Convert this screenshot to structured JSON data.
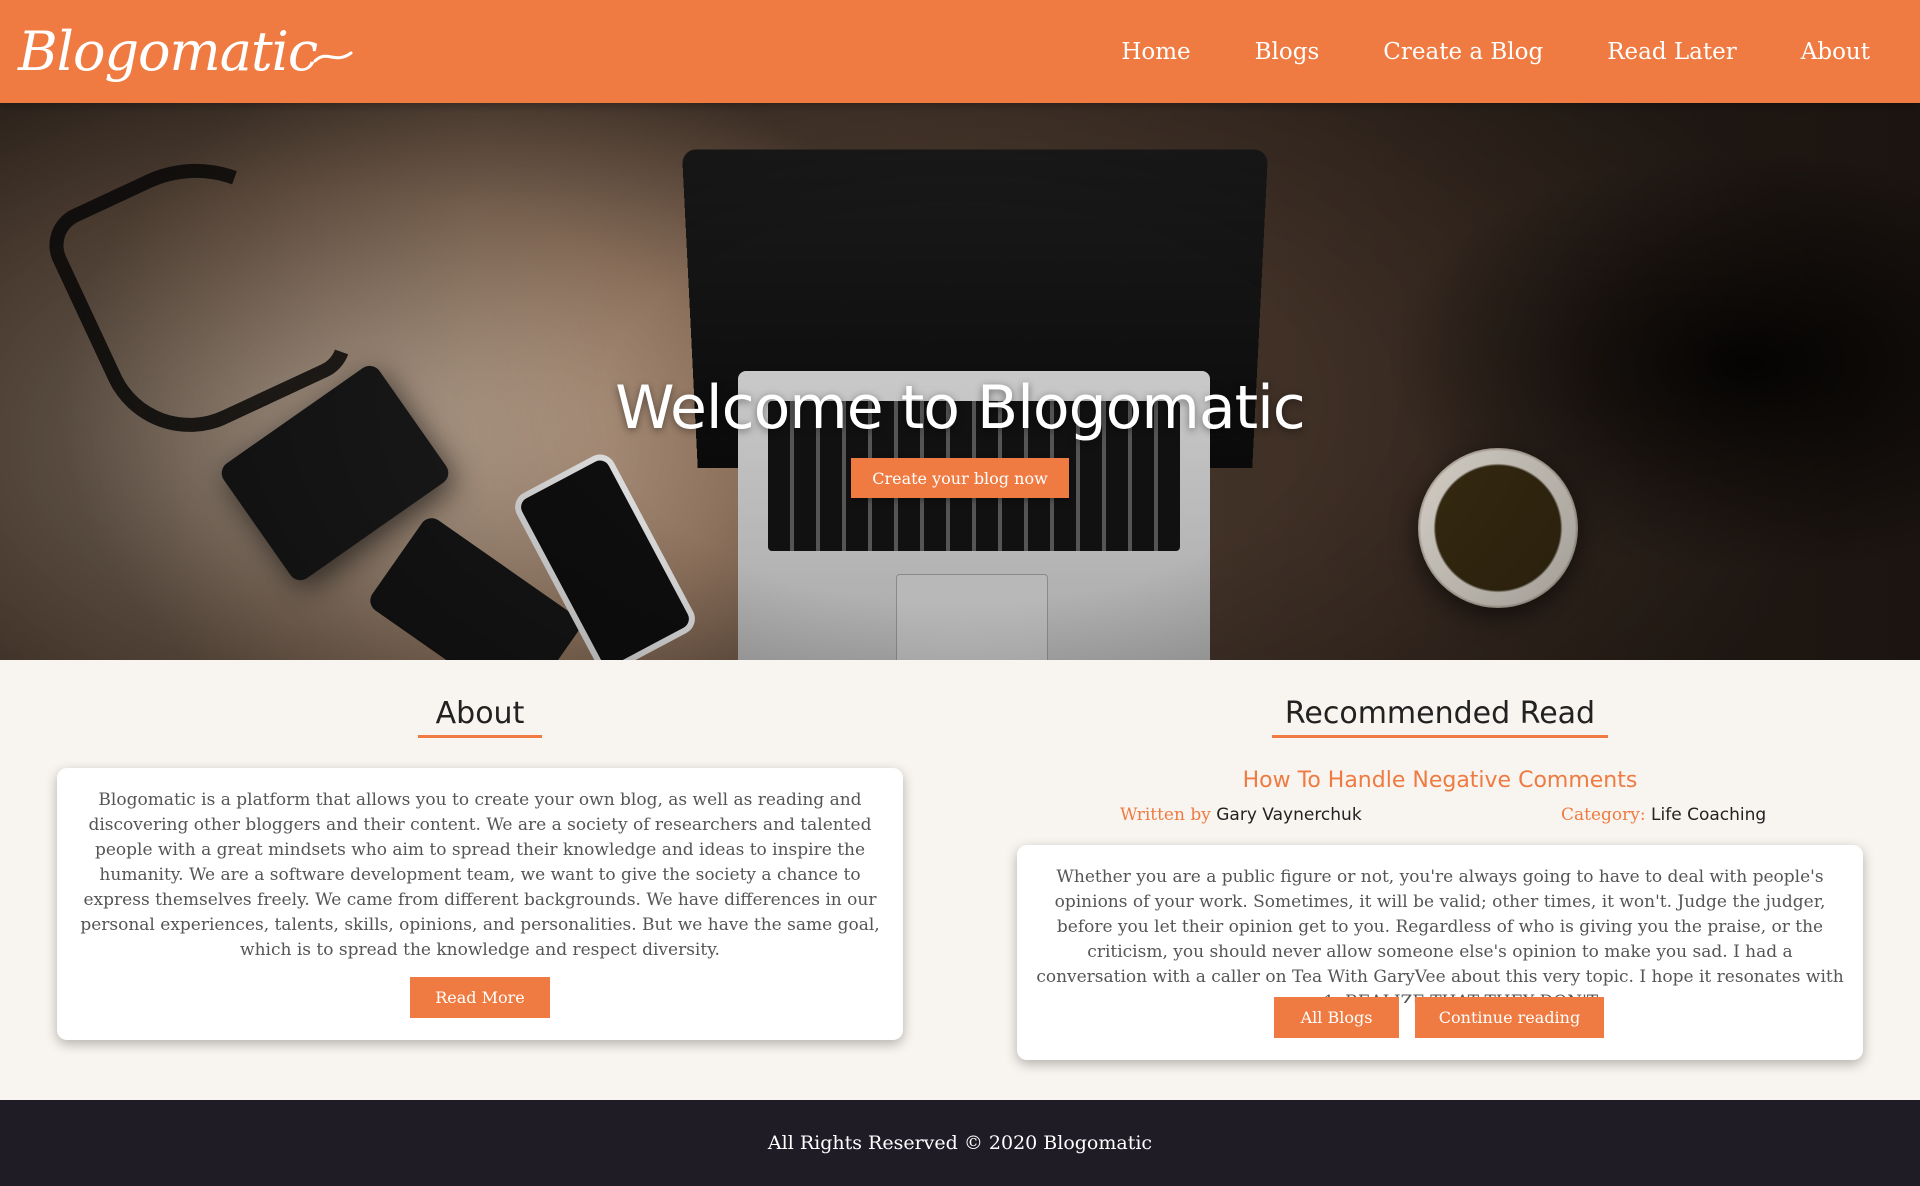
{
  "brand": {
    "name": "Blogomatic",
    "accent": "#ef7b42",
    "footer_bg": "#1f1c26",
    "page_bg": "#f8f4ef"
  },
  "nav": {
    "items": [
      {
        "label": "Home"
      },
      {
        "label": "Blogs"
      },
      {
        "label": "Create a Blog"
      },
      {
        "label": "Read Later"
      },
      {
        "label": "About"
      }
    ]
  },
  "hero": {
    "title": "Welcome to Blogomatic",
    "cta_label": "Create your blog now"
  },
  "about": {
    "heading": "About",
    "body": "Blogomatic is a platform that allows you to create your own blog, as well as reading and discovering other bloggers and their content. We are a society of researchers and talented people with a great mindsets who aim to spread their knowledge and ideas to inspire the humanity. We are a software development team, we want to give the society a chance to express themselves freely. We came from different backgrounds. We have differences in our personal experiences, talents, skills, opinions, and personalities. But we have the same goal, which is to spread the knowledge and respect diversity.",
    "read_more_label": "Read More"
  },
  "recommended": {
    "heading": "Recommended Read",
    "post_title": "How To Handle Negative Comments",
    "author_key": "Written by",
    "author": "Gary Vaynerchuk",
    "category_key": "Category:",
    "category": "Life Coaching",
    "excerpt": "Whether you are a public figure or not, you're always going to have to deal with people's opinions of your work. Sometimes, it will be valid; other times, it won't. Judge the judger, before you let their opinion get to you. Regardless of who is giving you the praise, or the criticism, you should never allow someone else's opinion to make you sad. I had a conversation with a caller on Tea With GaryVee about this very topic. I hope it resonates with you. 1. REALIZE THAT THEY DON'T",
    "all_blogs_label": "All Blogs",
    "continue_label": "Continue reading"
  },
  "footer": {
    "text": "All Rights Reserved © 2020 Blogomatic"
  }
}
